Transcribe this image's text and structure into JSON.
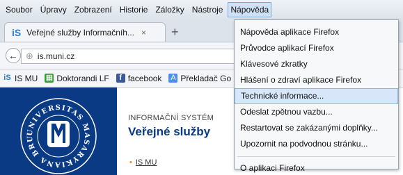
{
  "menubar": {
    "items": [
      "Soubor",
      "Úpravy",
      "Zobrazení",
      "Historie",
      "Záložky",
      "Nástroje",
      "Nápověda"
    ]
  },
  "tab": {
    "title": "Veřejné služby Informačníh...",
    "close": "×",
    "new_tab": "+"
  },
  "nav": {
    "url": "is.muni.cz"
  },
  "bookmarks": [
    {
      "label": "IS MU",
      "icon": "is-icon"
    },
    {
      "label": "Doktorandi LF",
      "icon": "grid-icon"
    },
    {
      "label": "facebook",
      "icon": "facebook-icon"
    },
    {
      "label": "Překladač Go",
      "icon": "translate-icon"
    }
  ],
  "page": {
    "subtitle": "INFORMAČNÍ SYSTÉM",
    "heading": "Veřejné služby",
    "link": "IS MU",
    "seal_text": "UNIVERSITAS MASARYKIANA BRUNENSIS"
  },
  "help_menu": {
    "items": [
      "Nápověda aplikace Firefox",
      "Průvodce aplikací Firefox",
      "Klávesové zkratky",
      "Hlášení o zdraví aplikace Firefox",
      "Technické informace...",
      "Odeslat zpětnou vazbu...",
      "Restartovat se zakázanými doplňky...",
      "Upozornit na podvodnou stránku...",
      "O aplikaci Firefox"
    ],
    "highlighted": "Technické informace..."
  },
  "colors": {
    "muni_blue": "#0a3a84",
    "accent_orange": "#e08a2a",
    "menu_highlight": "#d7e7f9"
  }
}
